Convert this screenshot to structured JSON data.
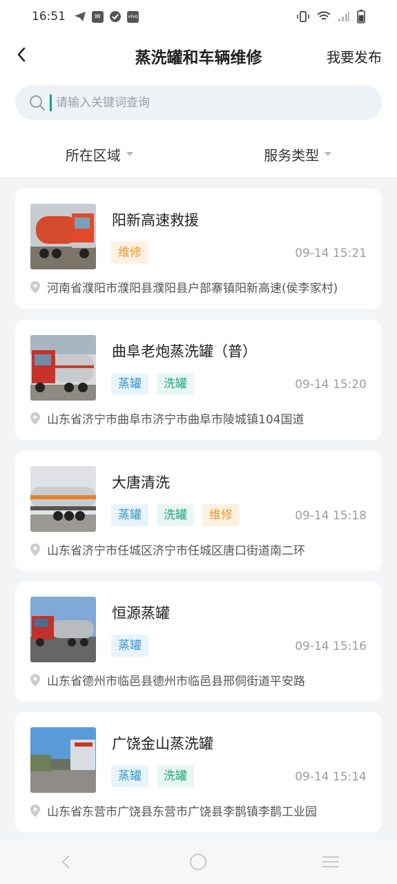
{
  "status_bar": {
    "time": "16:51",
    "app_icons": [
      "telegram-icon",
      "message-icon",
      "check-icon",
      "vivo-icon"
    ],
    "right_icons": [
      "vibrate-icon",
      "wifi-icon",
      "signal-icon",
      "battery-icon"
    ]
  },
  "header": {
    "title": "蒸洗罐和车辆维修",
    "publish_label": "我要发布"
  },
  "search": {
    "placeholder": "请输入关键词查询",
    "value": ""
  },
  "filters": [
    {
      "label": "所在区域"
    },
    {
      "label": "服务类型"
    }
  ],
  "tag_colors": {
    "蒸罐": "#3a97c9",
    "洗罐": "#21a682",
    "维修": "#e39a33"
  },
  "listings": [
    {
      "name": "阳新高速救援",
      "tags": [
        "维修"
      ],
      "time": "09-14 15:21",
      "address": "河南省濮阳市濮阳县濮阳县户部寨镇阳新高速(侯李家村)",
      "image": "red-tanker-truck"
    },
    {
      "name": "曲阜老炮蒸洗罐（普）",
      "tags": [
        "蒸罐",
        "洗罐"
      ],
      "time": "09-14 15:20",
      "address": "山东省济宁市曲阜市济宁市曲阜市陵城镇104国道",
      "image": "red-tanker-truck-warehouse"
    },
    {
      "name": "大唐清洗",
      "tags": [
        "蒸罐",
        "洗罐",
        "维修"
      ],
      "time": "09-14 15:18",
      "address": "山东省济宁市任城区济宁市任城区唐口街道南二环",
      "image": "silver-tank-trailer"
    },
    {
      "name": "恒源蒸罐",
      "tags": [
        "蒸罐"
      ],
      "time": "09-14 15:16",
      "address": "山东省德州市临邑县德州市临邑县邢侗街道平安路",
      "image": "red-truck-tanker-road"
    },
    {
      "name": "广饶金山蒸洗罐",
      "tags": [
        "蒸罐",
        "洗罐"
      ],
      "time": "09-14 15:14",
      "address": "山东省东营市广饶县东营市广饶县李鹊镇李鹊工业园",
      "image": "street-building"
    }
  ],
  "nav_bar": [
    "back-nav-icon",
    "home-nav-icon",
    "menu-nav-icon"
  ]
}
